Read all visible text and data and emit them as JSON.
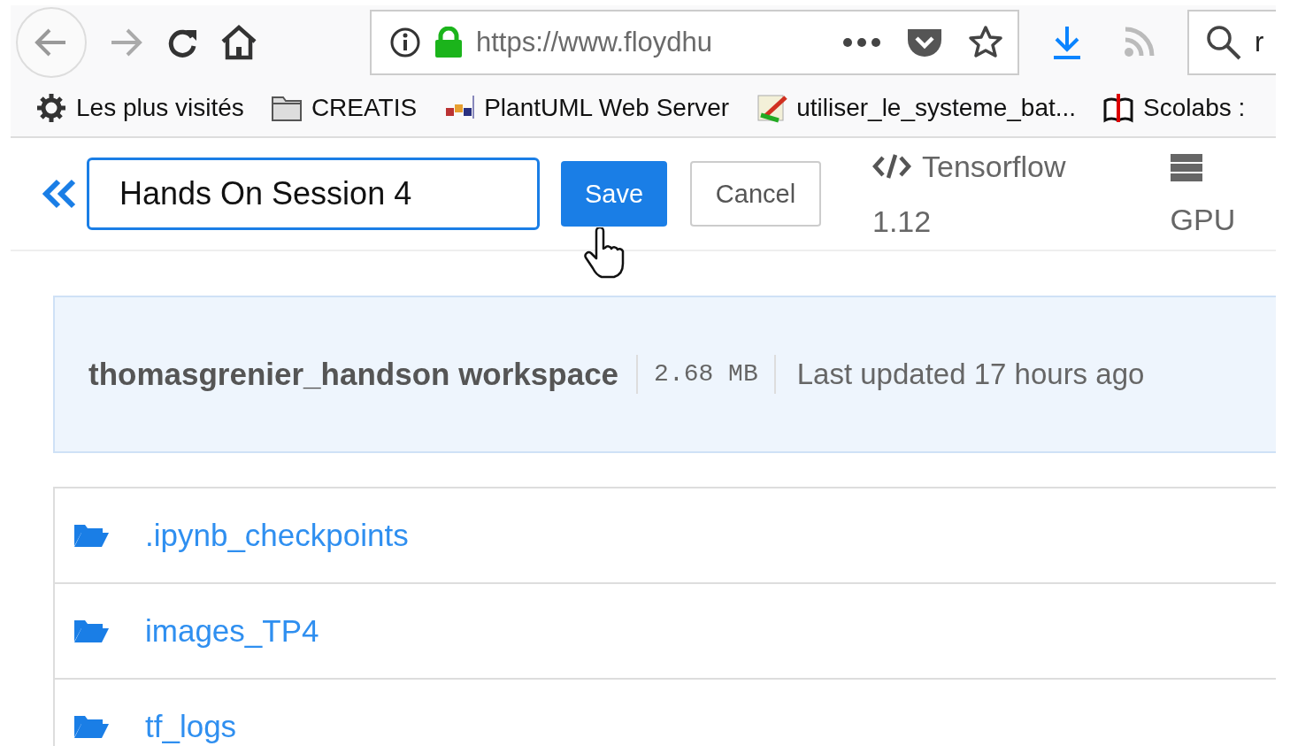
{
  "toolbar": {
    "url": "https://www.floydhu",
    "search_value": "r"
  },
  "bookmarks": [
    {
      "label": "Les plus visités",
      "kind": "gear"
    },
    {
      "label": "CREATIS",
      "kind": "folder"
    },
    {
      "label": "PlantUML Web Server",
      "kind": "diagram"
    },
    {
      "label": "utiliser_le_systeme_bat...",
      "kind": "pencil"
    },
    {
      "label": "Scolabs :",
      "kind": "book"
    }
  ],
  "header": {
    "title_value": "Hands On Session 4",
    "buttons": [
      {
        "label": "Save",
        "kind": "primary"
      },
      {
        "label": "Cancel",
        "kind": "secondary"
      }
    ],
    "environment": "Tensorflow",
    "version": "1.12",
    "machine": "GPU"
  },
  "workspace": {
    "name": "thomasgrenier_handson workspace",
    "size": "2.68 MB",
    "updated": "Last updated 17 hours ago"
  },
  "files": [
    {
      "name": ".ipynb_checkpoints"
    },
    {
      "name": "images_TP4"
    },
    {
      "name": "tf_logs"
    }
  ]
}
